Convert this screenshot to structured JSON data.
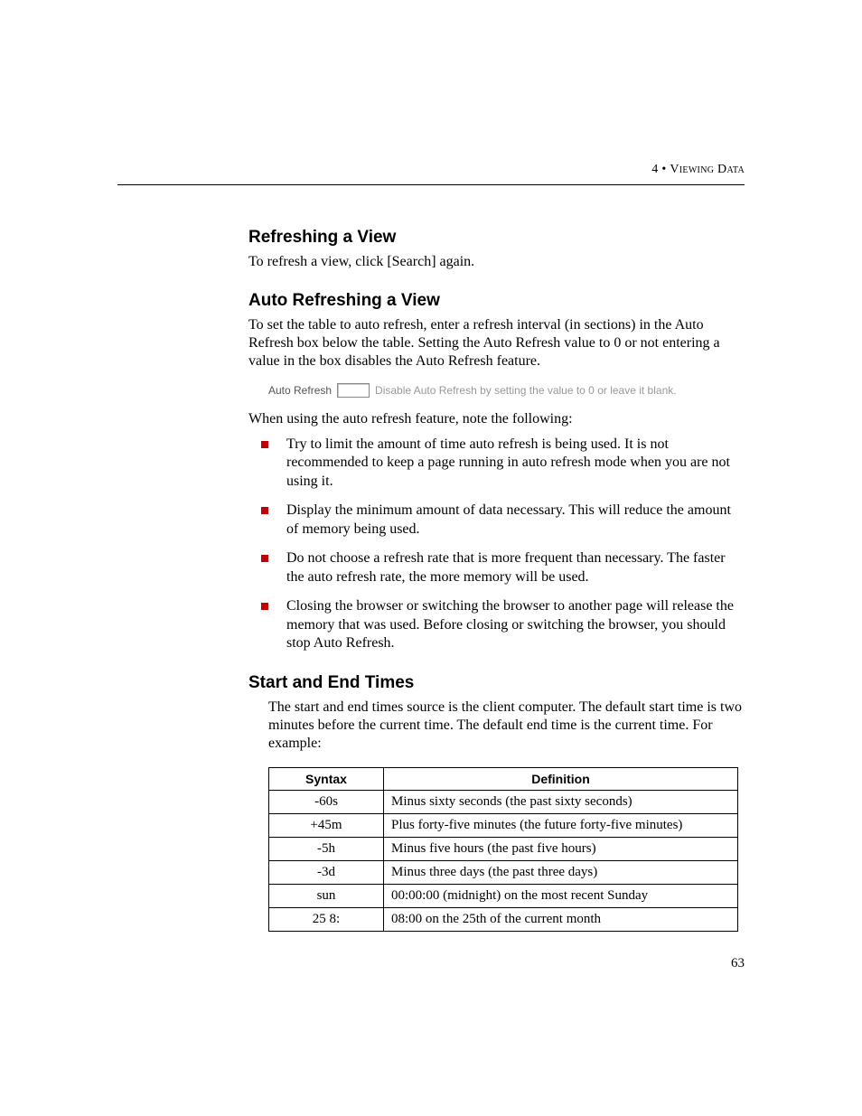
{
  "header": {
    "chapter_number": "4",
    "separator": "•",
    "chapter_title": "Viewing Data"
  },
  "sections": {
    "refreshing": {
      "heading": "Refreshing a View",
      "body": "To refresh a view, click [Search] again."
    },
    "auto_refreshing": {
      "heading": "Auto Refreshing a View",
      "intro": "To set the table to auto refresh, enter a refresh interval (in sections) in the Auto Refresh box below the table. Setting the Auto Refresh value to 0 or not entering a value in the box disables the Auto Refresh feature.",
      "figure": {
        "label": "Auto Refresh",
        "hint": "Disable Auto Refresh by setting the value to 0 or leave it blank."
      },
      "note_intro": "When using the auto refresh feature, note the following:",
      "bullets": [
        "Try to limit the amount of time auto refresh is being used. It is not recommended to keep a page running in auto refresh mode when you are not using it.",
        "Display the minimum amount of data necessary. This will reduce the amount of memory being used.",
        "Do not choose a refresh rate that is more frequent than necessary. The faster the auto refresh rate, the more memory will be used.",
        "Closing the browser or switching the browser to another page will release the memory that was used. Before closing or switching the browser, you should stop Auto Refresh."
      ]
    },
    "start_end": {
      "heading": "Start and End Times",
      "intro": "The start and end times source is the client computer. The default start time is two minutes before the current time. The default end time is the current time. For example:",
      "table": {
        "headers": {
          "syntax": "Syntax",
          "definition": "Definition"
        },
        "rows": [
          {
            "syntax": "-60s",
            "definition": "Minus sixty seconds (the past sixty seconds)"
          },
          {
            "syntax": "+45m",
            "definition": "Plus forty-five minutes (the future forty-five minutes)"
          },
          {
            "syntax": "-5h",
            "definition": "Minus five hours (the past five hours)"
          },
          {
            "syntax": "-3d",
            "definition": "Minus three days (the past three days)"
          },
          {
            "syntax": "sun",
            "definition": "00:00:00 (midnight) on the most recent Sunday"
          },
          {
            "syntax": "25 8:",
            "definition": "08:00 on the 25th of the current month"
          }
        ]
      }
    }
  },
  "page_number": "63"
}
